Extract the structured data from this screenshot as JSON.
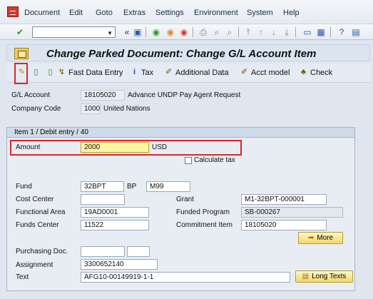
{
  "menubar": {
    "items": [
      "Document",
      "Edit",
      "Goto",
      "Extras",
      "Settings",
      "Environment",
      "System",
      "Help"
    ]
  },
  "toolbar": {
    "command_field": "",
    "icons": [
      "check-icon",
      "back-icon",
      "save-icon",
      "exit-icon",
      "cancel-icon",
      "print-icon",
      "find-icon",
      "page-icons",
      "window-icon",
      "help-icon",
      "layout-icon"
    ]
  },
  "title": "Change Parked Document: Change G/L Account Item",
  "app_toolbar": {
    "fast_data_entry": "Fast Data Entry",
    "tax": "Tax",
    "additional_data": "Additional Data",
    "acct_model": "Acct model",
    "check": "Check"
  },
  "header": {
    "gl_account_label": "G/L Account",
    "gl_account_value": "18105020",
    "gl_account_desc": "Advance UNDP Pay Agent Request",
    "company_code_label": "Company Code",
    "company_code_value": "1000",
    "company_code_desc": "United Nations"
  },
  "item": {
    "group_title": "Item 1 / Debit entry / 40",
    "amount_label": "Amount",
    "amount_value": "2000",
    "currency": "USD",
    "calculate_tax_label": "Calculate tax",
    "fund_label": "Fund",
    "fund_value": "32BPT",
    "fund_sep": "BP",
    "fund_extra": "M99",
    "cost_center_label": "Cost Center",
    "cost_center_value": "",
    "grant_label": "Grant",
    "grant_value": "M1-32BPT-000001",
    "functional_area_label": "Functional Area",
    "functional_area_value": "19AD0001",
    "funded_program_label": "Funded Program",
    "funded_program_value": "SB-000267",
    "funds_center_label": "Funds Center",
    "funds_center_value": "11522",
    "commitment_item_label": "Commitment Item",
    "commitment_item_value": "18105020",
    "more_label": "More",
    "purchasing_doc_label": "Purchasing Doc.",
    "purchasing_doc_value": "",
    "purchasing_doc_item": "",
    "assignment_label": "Assignment",
    "assignment_value": "3300652140",
    "text_label": "Text",
    "text_value": "AFG10-00149919-1-1",
    "long_texts_label": "Long Texts"
  }
}
